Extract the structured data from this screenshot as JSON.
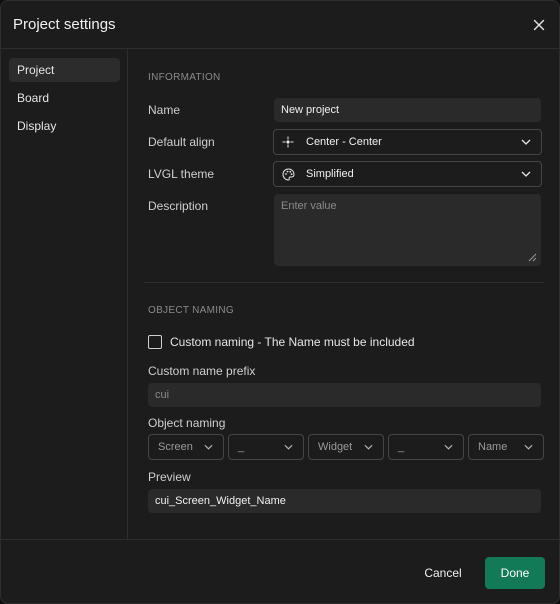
{
  "dialog": {
    "title": "Project settings"
  },
  "sidebar": {
    "items": [
      {
        "label": "Project",
        "active": true
      },
      {
        "label": "Board",
        "active": false
      },
      {
        "label": "Display",
        "active": false
      }
    ]
  },
  "information": {
    "section_title": "INFORMATION",
    "name_label": "Name",
    "name_value": "New project",
    "align_label": "Default align",
    "align_value": "Center - Center",
    "theme_label": "LVGL theme",
    "theme_value": "Simplified",
    "description_label": "Description",
    "description_placeholder": "Enter value"
  },
  "object_naming": {
    "section_title": "OBJECT NAMING",
    "checkbox_label": "Custom naming - The Name must be included",
    "checkbox_checked": false,
    "prefix_label": "Custom name prefix",
    "prefix_value": "cui",
    "naming_label": "Object naming",
    "segments": [
      "Screen",
      "_",
      "Widget",
      "_",
      "Name"
    ],
    "preview_label": "Preview",
    "preview_value": "cui_Screen_Widget_Name"
  },
  "footer": {
    "cancel_label": "Cancel",
    "done_label": "Done"
  },
  "colors": {
    "accent": "#127a57",
    "background": "#1c1c1c",
    "field": "#2a2a2a",
    "border": "#454545"
  },
  "icons": {
    "close": "close-icon",
    "align": "crosshair-icon",
    "theme": "palette-icon",
    "dropdown": "chevron-down-icon"
  }
}
